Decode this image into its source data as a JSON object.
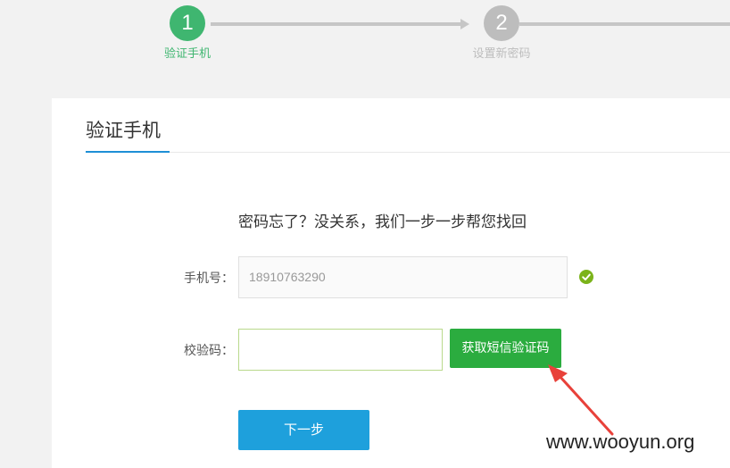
{
  "steps": [
    {
      "number": "1",
      "label": "验证手机",
      "active": true
    },
    {
      "number": "2",
      "label": "设置新密码",
      "active": false
    }
  ],
  "card": {
    "title": "验证手机",
    "subtitle": "密码忘了？没关系，我们一步一步帮您找回"
  },
  "form": {
    "phone_label": "手机号：",
    "phone_value": "18910763290",
    "code_label": "校验码：",
    "code_value": "",
    "sms_button": "获取短信验证码",
    "next_button": "下一步"
  },
  "watermark": "www.wooyun.org",
  "colors": {
    "active_step": "#3fb670",
    "inactive_step": "#bdbdbd",
    "tab_underline": "#1e8fd6",
    "sms_button": "#2bac3f",
    "next_button": "#1ea0dc",
    "annotation_arrow": "#e8413a"
  }
}
